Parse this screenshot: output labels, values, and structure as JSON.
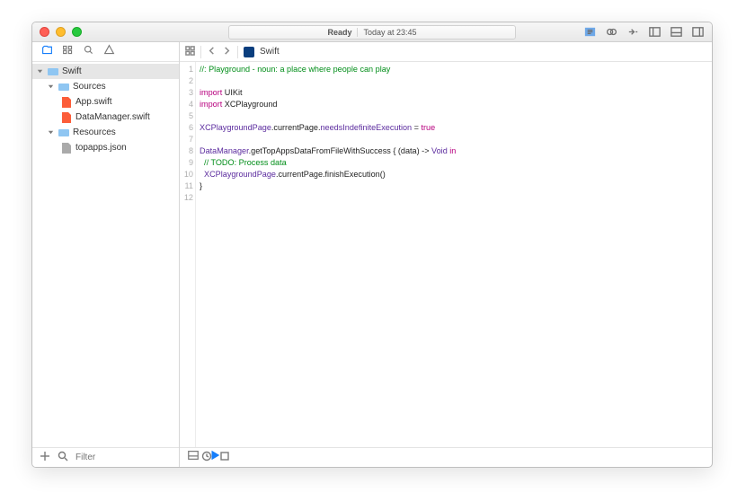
{
  "titlebar": {
    "status_label": "Ready",
    "status_time": "Today at 23:45"
  },
  "sidebar": {
    "filter_placeholder": "Filter",
    "tree": {
      "root_label": "Swift",
      "sources_label": "Sources",
      "sources_items": {
        "app_swift": "App.swift",
        "data_manager": "DataManager.swift"
      },
      "resources_label": "Resources",
      "resources_items": {
        "topapps_json": "topapps.json"
      }
    }
  },
  "jumpbar": {
    "file_label": "Swift"
  },
  "editor": {
    "line_count": 12,
    "lines": {
      "l1": "//: Playground - noun: a place where people can play",
      "l3_kw": "import",
      "l3_type": " UIKit",
      "l4_kw": "import",
      "l4_type": " XCPlayground",
      "l6_type": "XCPlaygroundPage",
      "l6_mid": ".currentPage.",
      "l6a": "needsIndefiniteExecution",
      "l6b": " = ",
      "l6_kw": "true",
      "l8_type": "DataManager",
      "l8a": ".getTopAppsDataFromFileWithSuccess { (data) -> ",
      "l8_kw": "Void",
      "l8b": " ",
      "l8_kw2": "in",
      "l9": "  // TODO: Process data",
      "l10_type": "  XCPlaygroundPage",
      "l10a": ".currentPage.finishExecution()",
      "l11": "}"
    }
  }
}
